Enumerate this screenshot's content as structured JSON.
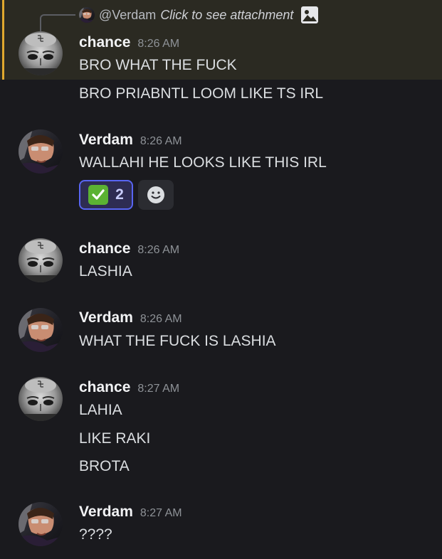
{
  "reply": {
    "username": "@Verdam",
    "text": "Click to see attachment",
    "icon": "image-icon"
  },
  "users": {
    "chance": {
      "name": "chance",
      "avatar": "grayscale-face-avatar"
    },
    "verdam": {
      "name": "Verdam",
      "avatar": "car-selfie-avatar"
    }
  },
  "groups": [
    {
      "author": "chance",
      "time": "8:26 AM",
      "messages": [
        "BRO WHAT THE FUCK",
        "BRO PRIABNTL LOOM LIKE TS IRL"
      ]
    },
    {
      "author": "Verdam",
      "time": "8:26 AM",
      "messages": [
        "WALLAHI HE LOOKS LIKE THIS IRL"
      ],
      "reaction": {
        "emoji": "white-check-mark",
        "count": "2",
        "add_icon": "add-reaction-smiley-icon"
      }
    },
    {
      "author": "chance",
      "time": "8:26 AM",
      "messages": [
        "LASHIA"
      ]
    },
    {
      "author": "Verdam",
      "time": "8:26 AM",
      "messages": [
        "WHAT THE FUCK IS LASHIA"
      ]
    },
    {
      "author": "chance",
      "time": "8:27 AM",
      "messages": [
        "LAHIA",
        "LIKE RAKI",
        "BROTA"
      ]
    },
    {
      "author": "Verdam",
      "time": "8:27 AM",
      "messages": [
        "????"
      ]
    }
  ],
  "colors": {
    "background": "#1a1a1e",
    "highlight": "#2b2a22",
    "highlight_bar": "#e0a82e",
    "reaction_border": "#5865f2",
    "reaction_bg": "#2e2c52"
  }
}
